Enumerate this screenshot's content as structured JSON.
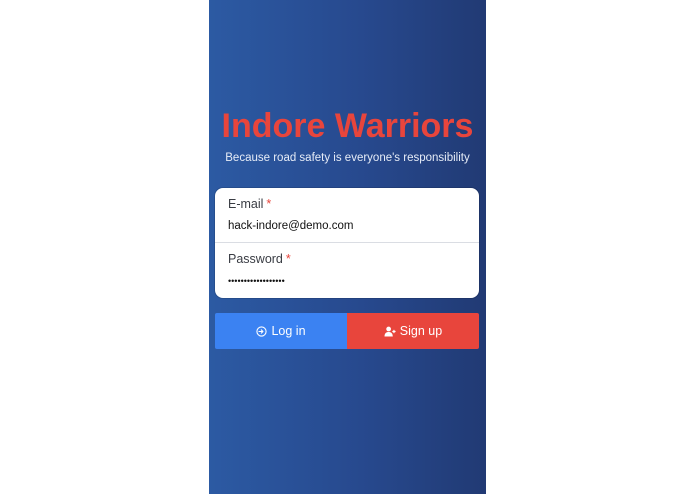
{
  "app": {
    "title": "Indore Warriors",
    "tagline": "Because road safety is everyone's responsibility"
  },
  "form": {
    "email": {
      "label": "E-mail",
      "required_mark": "*",
      "value": "hack-indore@demo.com"
    },
    "password": {
      "label": "Password",
      "required_mark": "*",
      "value": "hackindore2018demo"
    }
  },
  "actions": {
    "login_label": "Log in",
    "login_icon": "sign-in-icon",
    "signup_label": "Sign up",
    "signup_icon": "user-plus-icon"
  },
  "colors": {
    "brand_red": "#e8453c",
    "primary_blue": "#3b82f2",
    "panel_blue": "#27498e"
  }
}
